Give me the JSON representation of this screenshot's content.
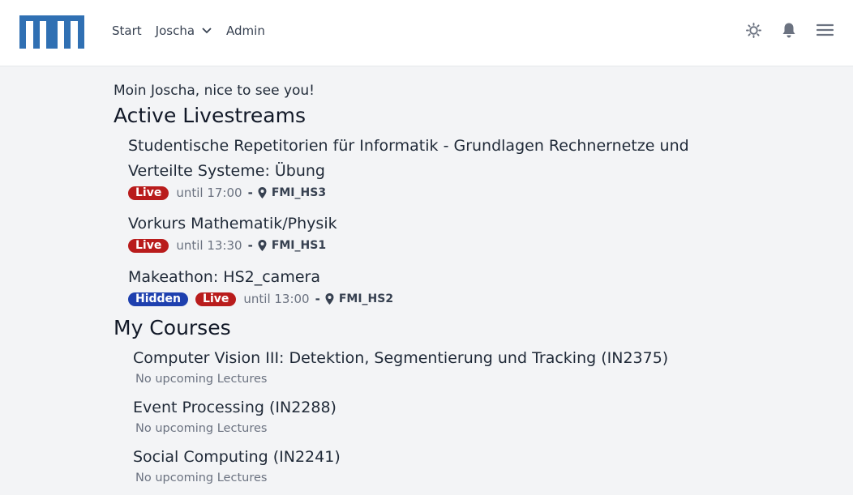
{
  "brand": {
    "logo_text": "TUM",
    "color": "#3070b3"
  },
  "nav": {
    "start": "Start",
    "user": "Joscha",
    "admin": "Admin"
  },
  "icons": [
    "theme-sun-icon",
    "bell-icon",
    "menu-icon"
  ],
  "greeting": "Moin Joscha, nice to see you!",
  "active_section": {
    "title": "Active Livestreams"
  },
  "streams": [
    {
      "title": "Studentische Repetitorien für Informatik - Grundlagen Rechnernetze und Verteilte Systeme: Übung",
      "badges": [
        "Live"
      ],
      "until": "until 17:00",
      "sep": "-",
      "room": "FMI_HS3"
    },
    {
      "title": "Vorkurs Mathematik/Physik",
      "badges": [
        "Live"
      ],
      "until": "until 13:30",
      "sep": "-",
      "room": "FMI_HS1"
    },
    {
      "title": "Makeathon: HS2_camera",
      "badges": [
        "Hidden",
        "Live"
      ],
      "until": "until 13:00",
      "sep": "-",
      "room": "FMI_HS2"
    }
  ],
  "courses_section": {
    "title": "My Courses"
  },
  "courses": [
    {
      "title": "Computer Vision III: Detektion, Segmentierung und Tracking (IN2375)",
      "sub": "No upcoming Lectures"
    },
    {
      "title": "Event Processing (IN2288)",
      "sub": "No upcoming Lectures"
    },
    {
      "title": "Social Computing (IN2241)",
      "sub": "No upcoming Lectures"
    }
  ],
  "colors": {
    "live": "#b91c1c",
    "hidden": "#1e40af",
    "background": "#f3f4f6"
  }
}
